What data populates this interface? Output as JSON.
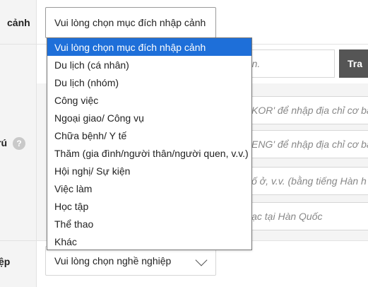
{
  "labels": {
    "purpose_tail": "cảnh",
    "address_tail": "rú",
    "job_tail": "ệp",
    "help_glyph": "?"
  },
  "purpose_select": {
    "value": "Vui lòng chọn mục đích nhập cảnh"
  },
  "dropdown": {
    "options": [
      "Vui lòng chọn mục đích nhập cảnh",
      "Du lịch (cá nhân)",
      "Du lịch (nhóm)",
      "Công việc",
      "Ngoại giao/ Công vụ",
      "Chữa bệnh/ Y tế",
      "Thăm (gia đình/người thân/người quen, v.v.)",
      "Hội nghị/ Sự kiện",
      "Việc làm",
      "Học tập",
      "Thể thao",
      "Khác"
    ],
    "selected_index": 0
  },
  "address": {
    "search_placeholder_tail": "bạn.",
    "search_button": "Tra",
    "kor_hint": "KOR' để nhập địa chỉ cơ bả",
    "eng_hint": "ENG' để nhập địa chỉ cơ bả",
    "residence_hint": "ố ở, v.v. (bằng tiếng Hàn h",
    "contact_hint": "lạc tại Hàn Quốc"
  },
  "job_select": {
    "value": "Vui lòng chọn nghề nghiệp"
  },
  "colors": {
    "selected_option_bg": "#1e6fd9",
    "search_button_bg": "#555555",
    "label_column_bg": "#f4f4f4"
  }
}
